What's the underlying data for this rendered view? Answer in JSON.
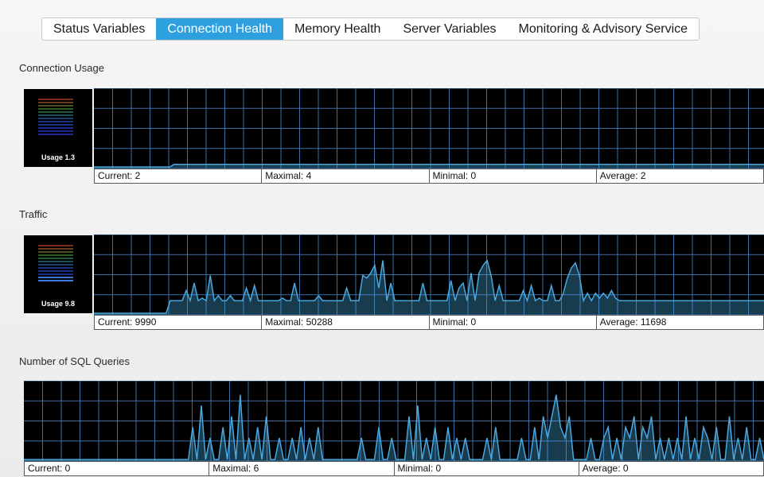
{
  "tabs": [
    {
      "label": "Status Variables",
      "active": false
    },
    {
      "label": "Connection Health",
      "active": true
    },
    {
      "label": "Memory Health",
      "active": false
    },
    {
      "label": "Server Variables",
      "active": false
    },
    {
      "label": "Monitoring & Advisory Service",
      "active": false
    }
  ],
  "colors": {
    "tab_active": "#2ea0e0",
    "graph_background": "#000000",
    "grid_line": "#3b6fa8",
    "series_line": "#49a8e0"
  },
  "connection_usage": {
    "title": "Connection Usage",
    "meter_label": "Usage 1.3",
    "stats": {
      "current": "Current: 2",
      "maximal": "Maximal: 4",
      "minimal": "Minimal: 0",
      "average": "Average: 2"
    },
    "series": [
      0,
      0,
      0,
      0,
      0,
      0,
      0,
      0,
      0,
      0,
      0,
      0,
      0,
      0,
      0,
      0,
      0,
      0,
      0,
      2,
      2,
      2,
      2,
      2,
      2,
      2,
      2,
      2,
      2,
      2,
      2,
      2,
      2,
      2,
      2,
      2,
      2,
      2,
      2,
      2,
      2,
      2,
      2,
      2,
      2,
      2,
      2,
      2,
      2,
      2,
      2,
      2,
      2,
      2,
      2,
      2,
      2,
      2,
      2,
      2,
      2,
      2,
      2,
      2,
      2,
      2,
      2,
      2,
      2,
      2,
      2,
      2,
      2,
      2,
      2,
      2,
      2,
      2,
      2,
      2,
      2,
      2,
      2,
      2,
      2,
      2,
      2,
      2,
      2,
      2,
      2,
      2,
      2,
      2,
      2,
      2,
      2,
      2,
      2,
      2,
      2,
      2,
      2,
      2,
      2,
      2,
      2,
      2,
      2,
      2,
      2,
      2,
      2,
      2,
      2,
      2,
      2,
      2,
      2,
      2,
      2,
      2,
      2,
      2,
      2,
      2,
      2,
      2,
      2,
      2,
      2,
      2,
      2,
      2,
      2,
      2,
      2,
      2,
      2,
      2,
      2,
      2,
      2,
      2,
      2,
      2,
      2,
      2,
      2,
      2,
      2,
      2,
      2,
      2,
      2,
      2,
      2,
      2,
      2,
      2
    ],
    "ymax": 60
  },
  "traffic": {
    "title": "Traffic",
    "meter_label": "Usage 9.8",
    "stats": {
      "current": "Current: 9990",
      "maximal": "Maximal: 50288",
      "minimal": "Minimal: 0",
      "average": "Average: 11698"
    },
    "series": [
      0,
      0,
      0,
      0,
      0,
      0,
      0,
      0,
      0,
      0,
      0,
      0,
      0,
      0,
      0,
      0,
      0,
      0,
      0,
      9990,
      9990,
      9990,
      9990,
      18000,
      9990,
      24000,
      9990,
      12000,
      9990,
      30000,
      9990,
      14000,
      9990,
      9990,
      14000,
      9990,
      9990,
      9990,
      20000,
      9990,
      22000,
      9990,
      9990,
      9990,
      9990,
      9990,
      9990,
      12000,
      9990,
      9990,
      24000,
      9990,
      9990,
      9990,
      9990,
      9990,
      14000,
      9990,
      9990,
      9990,
      9990,
      9990,
      9990,
      20000,
      9990,
      9990,
      9990,
      30000,
      28000,
      32000,
      38000,
      20000,
      42000,
      9990,
      24000,
      9990,
      9990,
      9990,
      9990,
      9990,
      9990,
      9990,
      24000,
      9990,
      9990,
      9990,
      9990,
      9990,
      9990,
      26000,
      9990,
      20000,
      24000,
      9990,
      32000,
      9990,
      32000,
      38000,
      42000,
      30000,
      9990,
      22000,
      9990,
      9990,
      9990,
      9990,
      9990,
      18000,
      9990,
      22000,
      9990,
      12000,
      9990,
      9990,
      22000,
      9990,
      9990,
      16000,
      28000,
      36000,
      40000,
      30000,
      9990,
      16000,
      9990,
      16000,
      12000,
      16000,
      12000,
      18000,
      12000,
      9990,
      9990,
      9990,
      9990,
      9990,
      9990,
      9990,
      9990,
      9990,
      9990,
      9990,
      9990,
      9990,
      9990,
      9990,
      9990,
      9990,
      9990,
      9990,
      9990,
      9990,
      9990,
      9990,
      9990,
      9990,
      9990,
      9990,
      9990,
      9990,
      9990,
      9990,
      9990,
      9990,
      9990,
      9990,
      9990,
      9990
    ],
    "ymax": 60000
  },
  "sql_queries": {
    "title": "Number of SQL Queries",
    "stats": {
      "current": "Current: 0",
      "maximal": "Maximal: 6",
      "minimal": "Minimal: 0",
      "average": "Average: 0"
    },
    "series": [
      0,
      0,
      0,
      0,
      0,
      0,
      0,
      0,
      0,
      0,
      0,
      0,
      0,
      0,
      0,
      0,
      0,
      0,
      0,
      0,
      0,
      0,
      0,
      0,
      0,
      0,
      0,
      0,
      0,
      0,
      0,
      0,
      0,
      0,
      0,
      0,
      0,
      0,
      0,
      3,
      0,
      5,
      0,
      2,
      0,
      0,
      3,
      0,
      4,
      0,
      6,
      0,
      2,
      0,
      3,
      0,
      4,
      0,
      0,
      2,
      0,
      0,
      2,
      0,
      3,
      0,
      2,
      0,
      3,
      0,
      0,
      0,
      0,
      0,
      0,
      0,
      0,
      0,
      2,
      0,
      0,
      0,
      3,
      0,
      0,
      2,
      0,
      0,
      0,
      4,
      0,
      5,
      0,
      2,
      0,
      3,
      0,
      0,
      3,
      0,
      2,
      0,
      2,
      0,
      0,
      0,
      0,
      2,
      0,
      3,
      0,
      0,
      0,
      0,
      0,
      2,
      0,
      0,
      3,
      0,
      4,
      2,
      4,
      6,
      3,
      2,
      4,
      0,
      0,
      0,
      0,
      2,
      0,
      0,
      2,
      3,
      0,
      2,
      0,
      3,
      2,
      4,
      0,
      3,
      2,
      4,
      0,
      2,
      0,
      2,
      0,
      2,
      0,
      4,
      0,
      2,
      0,
      3,
      2,
      0,
      3,
      0,
      0,
      4,
      0,
      2,
      0,
      3,
      0,
      0,
      2,
      0
    ],
    "ymax": 7
  }
}
